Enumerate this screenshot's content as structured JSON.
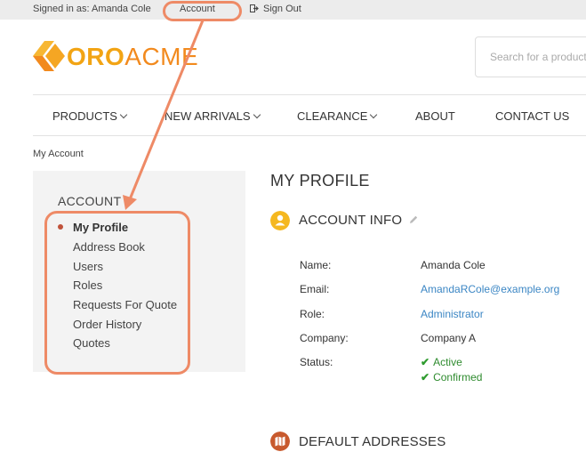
{
  "topbar": {
    "signed_in": "Signed in as: Amanda Cole",
    "account_link": "Account",
    "sign_out": "Sign Out"
  },
  "header": {
    "logo_part1": "ORO",
    "logo_part2": "ACME",
    "search_placeholder": "Search for a product"
  },
  "nav": {
    "products": "PRODUCTS",
    "new_arrivals": "NEW ARRIVALS",
    "clearance": "CLEARANCE",
    "about": "ABOUT",
    "contact": "CONTACT US"
  },
  "breadcrumb": "My Account",
  "sidebar": {
    "title": "ACCOUNT",
    "items": [
      {
        "label": "My Profile"
      },
      {
        "label": "Address Book"
      },
      {
        "label": "Users"
      },
      {
        "label": "Roles"
      },
      {
        "label": "Requests For Quote"
      },
      {
        "label": "Order History"
      },
      {
        "label": "Quotes"
      }
    ]
  },
  "main": {
    "page_title": "MY PROFILE",
    "account_info_title": "ACCOUNT INFO",
    "labels": {
      "name": "Name:",
      "email": "Email:",
      "role": "Role:",
      "company": "Company:",
      "status": "Status:"
    },
    "values": {
      "name": "Amanda Cole",
      "email": "AmandaRCole@example.org",
      "role": "Administrator",
      "company": "Company A",
      "status_active": "Active",
      "status_confirmed": "Confirmed"
    },
    "default_addresses_title": "DEFAULT ADDRESSES"
  },
  "colors": {
    "accent_orange": "#f28a1e",
    "link_blue": "#3b86c4",
    "status_green": "#2e8b2e",
    "annotation": "#ee8a66"
  }
}
